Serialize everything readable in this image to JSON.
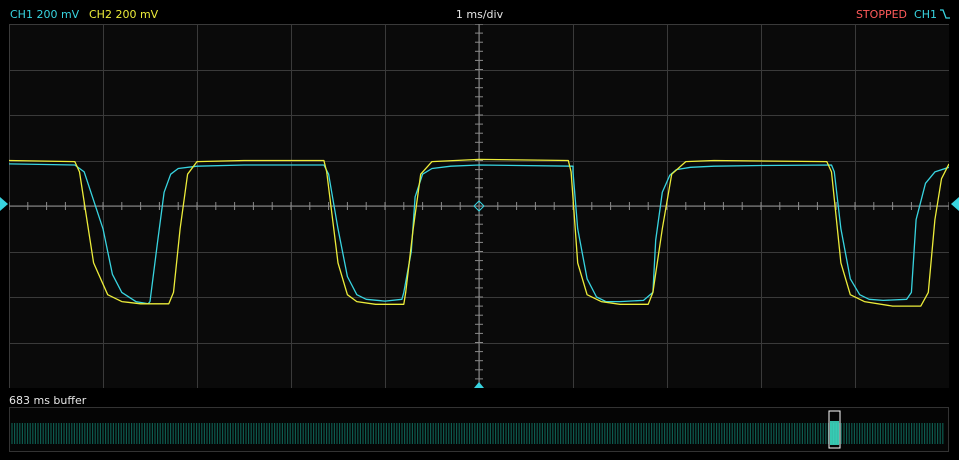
{
  "header": {
    "ch1": "CH1 200 mV",
    "ch2": "CH2 200 mV",
    "timebase": "1 ms/div",
    "status": "STOPPED",
    "trigger_source": "CH1",
    "trigger_edge_icon": "rising-edge-icon"
  },
  "buffer": {
    "label": "683 ms buffer"
  },
  "colors": {
    "ch1": "#38d4e0",
    "ch2": "#ecec3a",
    "status": "#ff5a5a",
    "grid": "#3a3a3a",
    "background": "#0a0a0a",
    "buffer_wave": "#0d5a4e"
  },
  "chart_data": {
    "type": "line",
    "title": "",
    "xlabel": "",
    "ylabel": "",
    "x_unit": "ms",
    "y_unit": "mV",
    "xlim": [
      -5,
      5
    ],
    "ylim": [
      -800,
      800
    ],
    "grid": true,
    "x_divisions": 10,
    "y_divisions": 8,
    "series": [
      {
        "name": "CH1",
        "color": "#38d4e0",
        "x": [
          -5,
          -4.3,
          -4.2,
          -4.0,
          -3.9,
          -3.8,
          -3.65,
          -3.52,
          -3.5,
          -3.42,
          -3.35,
          -3.28,
          -3.2,
          -3.0,
          -2.5,
          -1.65,
          -1.6,
          -1.5,
          -1.4,
          -1.3,
          -1.2,
          -1.0,
          -0.82,
          -0.8,
          -0.72,
          -0.68,
          -0.6,
          -0.5,
          -0.3,
          0,
          1.0,
          1.0,
          1.05,
          1.15,
          1.25,
          1.35,
          1.5,
          1.75,
          1.85,
          1.88,
          1.95,
          2.03,
          2.1,
          2.25,
          2.5,
          3.0,
          3.75,
          3.78,
          3.85,
          3.95,
          4.05,
          4.15,
          4.3,
          4.55,
          4.6,
          4.65,
          4.75,
          4.85,
          5.0
        ],
        "y": [
          185,
          180,
          150,
          -100,
          -300,
          -380,
          -420,
          -430,
          -420,
          -160,
          60,
          140,
          165,
          175,
          180,
          180,
          140,
          -100,
          -310,
          -390,
          -410,
          -418,
          -410,
          -380,
          -200,
          40,
          140,
          165,
          175,
          180,
          175,
          150,
          -100,
          -320,
          -400,
          -420,
          -420,
          -415,
          -380,
          -150,
          60,
          135,
          160,
          170,
          175,
          178,
          180,
          150,
          -100,
          -320,
          -390,
          -410,
          -415,
          -410,
          -380,
          -60,
          100,
          150,
          170
        ]
      },
      {
        "name": "CH2",
        "color": "#ecec3a",
        "x": [
          -5,
          -4.3,
          -4.25,
          -4.1,
          -3.95,
          -3.8,
          -3.6,
          -3.3,
          -3.25,
          -3.18,
          -3.1,
          -3.0,
          -2.5,
          -1.65,
          -1.62,
          -1.5,
          -1.4,
          -1.3,
          -1.1,
          -0.8,
          -0.78,
          -0.7,
          -0.62,
          -0.5,
          0,
          0.95,
          0.98,
          1.05,
          1.15,
          1.3,
          1.5,
          1.8,
          1.85,
          1.95,
          2.05,
          2.2,
          2.5,
          3.7,
          3.75,
          3.85,
          3.95,
          4.1,
          4.4,
          4.7,
          4.78,
          4.85,
          4.92,
          5.0
        ],
        "y": [
          200,
          195,
          150,
          -250,
          -390,
          -420,
          -430,
          -430,
          -380,
          -100,
          140,
          195,
          200,
          200,
          150,
          -250,
          -390,
          -420,
          -432,
          -432,
          -380,
          -100,
          140,
          195,
          205,
          200,
          150,
          -250,
          -390,
          -420,
          -432,
          -432,
          -380,
          -100,
          140,
          195,
          200,
          195,
          150,
          -250,
          -390,
          -420,
          -440,
          -440,
          -380,
          -60,
          120,
          185
        ]
      }
    ]
  }
}
